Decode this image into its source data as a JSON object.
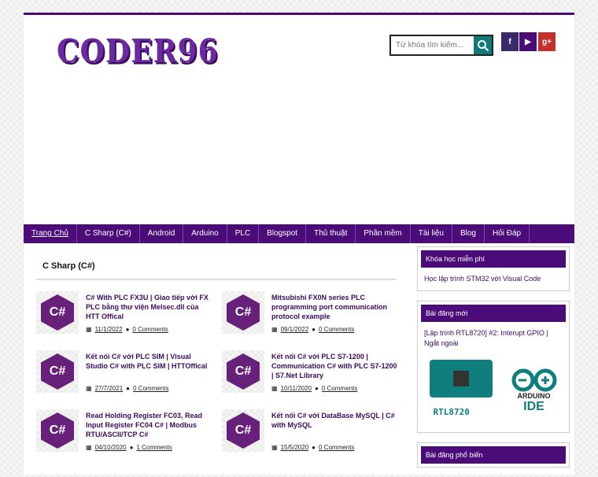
{
  "header": {
    "logo": "CODER96",
    "search_placeholder": "Từ khóa tìm kiếm...",
    "social": {
      "facebook": "f",
      "youtube": "▶",
      "google": "g+"
    }
  },
  "nav": [
    "Trang Chủ",
    "C Sharp (C#)",
    "Android",
    "Arduino",
    "PLC",
    "Blogspot",
    "Thủ thuật",
    "Phần mềm",
    "Tài liệu",
    "Blog",
    "Hỏi Đáp"
  ],
  "section": {
    "title": "C Sharp (C#)",
    "posts": [
      {
        "title": "C# With PLC FX3U | Giao tiếp với FX PLC bằng thư viện Melsec.dll của HTT Offical",
        "date": "11/1/2022",
        "comments": "0 Comments"
      },
      {
        "title": "Mitsubishi FX0N series PLC programming port communication protocol example",
        "date": "09/1/2022",
        "comments": "0 Comments"
      },
      {
        "title": "Kết nối C# với PLC SIM | Visual Studio C# with PLC SIM | HTTOffical",
        "date": "27/7/2021",
        "comments": "0 Comments"
      },
      {
        "title": "Kết nối C# với PLC S7-1200 | Communication C# with PLC S7-1200 | S7.Net Library",
        "date": "10/11/2020",
        "comments": "0 Comments"
      },
      {
        "title": "Read Holding Register FC03, Read Input Register FC04 C# | Modbus RTU/ASCII/TCP C#",
        "date": "04/10/2020",
        "comments": "1 Comments"
      },
      {
        "title": "Kết nối C# với DataBase MySQL | C# with MySQL",
        "date": "15/5/2020",
        "comments": "0 Comments"
      }
    ],
    "thumb_text": "C#"
  },
  "sidebar": {
    "w1_title": "Khóa học miễn phí",
    "w1_link": "Học lập trình STM32 với Visual Code",
    "w2_title": "Bài đăng mới",
    "w2_link": "[Lập trình RTL8720] #2: Interupt GPIO | Ngắt ngoài",
    "w2_img_left": "RTL8720",
    "w2_img_right1": "ARDUINO",
    "w2_img_right2": "IDE",
    "w3_title": "Bài đăng phổ biến"
  },
  "colors": {
    "primary": "#4b0c7a",
    "accent": "#0f7a78",
    "csharp": "#68217a"
  }
}
